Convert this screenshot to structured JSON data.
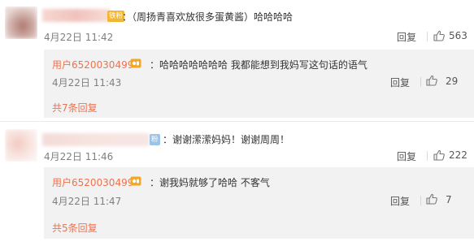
{
  "comments": [
    {
      "badge": "铁粉",
      "text": "：（周扬青喜欢放很多蛋黄酱）哈哈哈哈",
      "time": "4月22日 11:42",
      "reply_label": "回复",
      "like_icon": "thumbs-up-icon",
      "likes": "563",
      "reply": {
        "user": "用户6520030499",
        "flag_icon": "fan-badge-icon",
        "text": "：哈哈哈哈哈哈哈 我都能想到我妈写这句话的语气",
        "time": "4月22日 11:43",
        "reply_label": "回复",
        "like_icon": "thumbs-up-icon",
        "likes": "29"
      },
      "more_replies": "共7条回复"
    },
    {
      "badge": "粉",
      "text": "：谢谢潆潆妈妈！谢谢周周！",
      "time": "4月22日 11:46",
      "reply_label": "回复",
      "like_icon": "thumbs-up-icon",
      "likes": "222",
      "reply": {
        "user": "用户6520030499",
        "flag_icon": "fan-badge-icon",
        "text": "：谢我妈就够了哈哈 不客气",
        "time": "4月22日 11:47",
        "reply_label": "回复",
        "like_icon": "thumbs-up-icon",
        "likes": "7"
      },
      "more_replies": "共5条回复"
    }
  ],
  "colors": {
    "username": "#eb7350",
    "reply_bg": "#f2f2f2",
    "meta_text": "#808080"
  }
}
